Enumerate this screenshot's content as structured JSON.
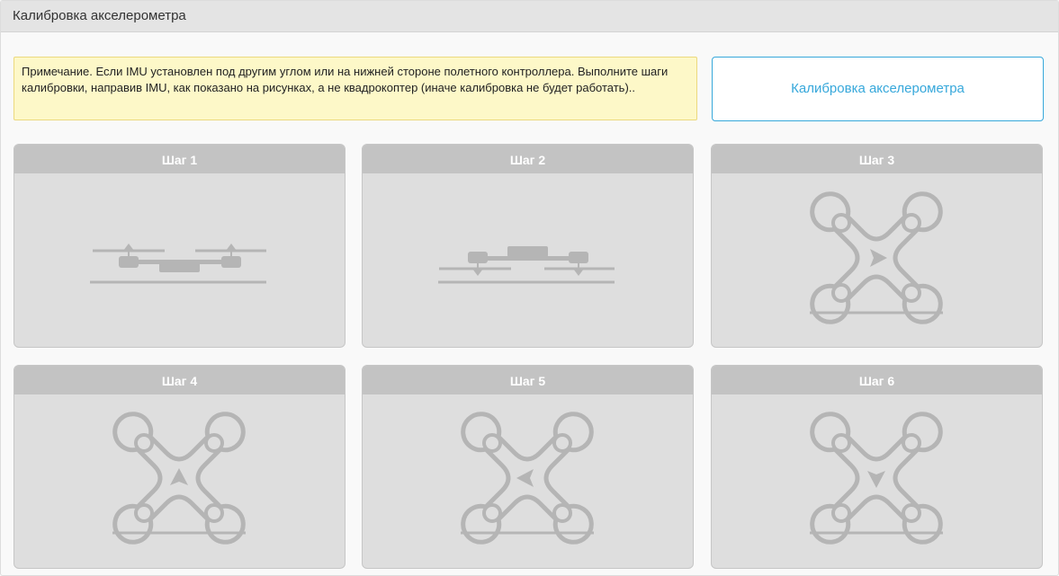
{
  "panel": {
    "title": "Калибровка акселерометра"
  },
  "note": {
    "text": "Примечание. Если IMU установлен под другим углом или на нижней стороне полетного контроллера. Выполните шаги калибровки, направив IMU, как показано на рисунках, а не квадрокоптер (иначе калибровка не будет работать).."
  },
  "calibrate_button": {
    "label": "Калибровка акселерометра"
  },
  "steps": [
    {
      "label": "Шаг 1",
      "icon": "drone-side-props-up-icon"
    },
    {
      "label": "Шаг 2",
      "icon": "drone-side-props-down-icon"
    },
    {
      "label": "Шаг 3",
      "icon": "drone-top-arrow-right-icon"
    },
    {
      "label": "Шаг 4",
      "icon": "drone-top-arrow-up-icon"
    },
    {
      "label": "Шаг 5",
      "icon": "drone-top-arrow-left-icon"
    },
    {
      "label": "Шаг 6",
      "icon": "drone-top-arrow-down-icon"
    }
  ],
  "colors": {
    "accent": "#37a8db",
    "note_bg": "#fdf8c8",
    "card_header": "#c3c3c3",
    "card_body": "#dedede",
    "icon": "#b5b5b5"
  }
}
